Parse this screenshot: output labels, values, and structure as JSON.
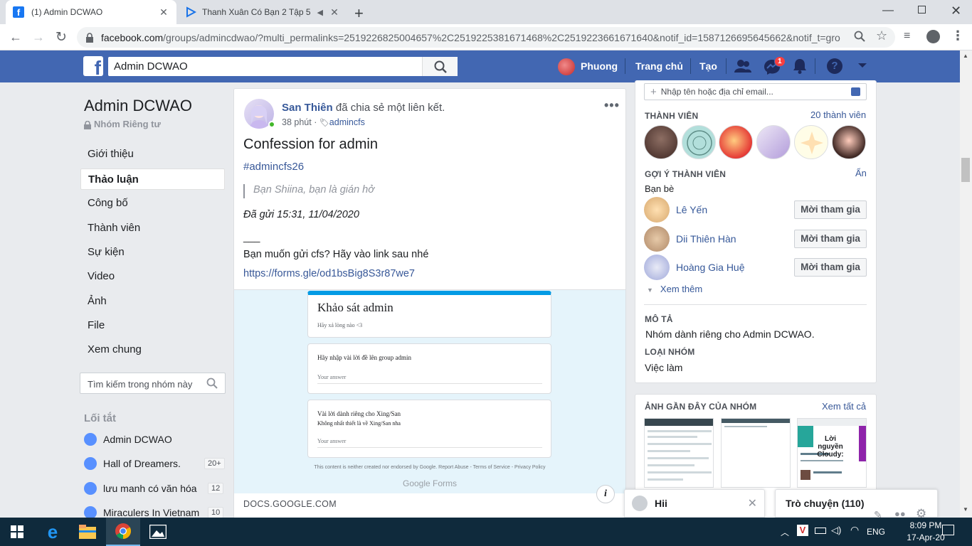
{
  "browser": {
    "tabs": [
      {
        "title": "(1) Admin DCWAO",
        "active": true
      },
      {
        "title": "Thanh Xuân Có Bạn 2 Tập 5",
        "active": false
      }
    ],
    "url_host": "facebook.com",
    "url_rest": "/groups/admincdwao/?multi_permalinks=2519226825004657%2C2519225381671468%2C2519223661671640&notif_id=1587126695645662&notif_t=gro..."
  },
  "fb_header": {
    "search_value": "Admin DCWAO",
    "user_name": "Phuong",
    "home_label": "Trang chủ",
    "create_label": "Tạo",
    "messenger_badge": "1",
    "brand_color": "#4267b2"
  },
  "group": {
    "name": "Admin DCWAO",
    "privacy": "Nhóm Riêng tư",
    "nav": [
      {
        "label": "Giới thiệu"
      },
      {
        "label": "Thảo luận",
        "selected": true
      },
      {
        "label": "Công bố"
      },
      {
        "label": "Thành viên"
      },
      {
        "label": "Sự kiện"
      },
      {
        "label": "Video"
      },
      {
        "label": "Ảnh"
      },
      {
        "label": "File"
      },
      {
        "label": "Xem chung"
      }
    ],
    "search_placeholder": "Tìm kiếm trong nhóm này",
    "shortcuts_title": "Lối tắt",
    "shortcuts": [
      {
        "label": "Admin DCWAO",
        "badge": ""
      },
      {
        "label": "Hall of Dreamers.",
        "badge": "20+"
      },
      {
        "label": "lưu manh có văn hóa",
        "badge": "12"
      },
      {
        "label": "Miraculers In Vietnam",
        "badge": "10"
      }
    ]
  },
  "post": {
    "author": "San Thiên",
    "action": "đã chia sẻ một liên kết.",
    "time": "38 phút",
    "tag": "admincfs",
    "title": "Confession for admin",
    "hashtag": "#admincfs26",
    "quote": "Bạn Shiina, bạn là gián hở",
    "sent": "Đã gửi 15:31, 11/04/2020",
    "separator": "___",
    "cta": "Bạn muốn gửi cfs? Hãy vào link sau nhé",
    "link": "https://forms.gle/od1bsBig8S3r87we7",
    "preview": {
      "form_title": "Khảo sát admin",
      "form_subtitle": "Hãy xả lòng nào <3",
      "q1": "Hãy nhập vài lời đề lên group admin",
      "q1_answer": "Your answer",
      "q2": "Vài lời dành riêng cho Xing/San",
      "q2_sub": "Không nhất thiết là về Xing/San nha",
      "q2_answer": "Your answer",
      "footer": "This content is neither created nor endorsed by Google. Report Abuse - Terms of Service - Privacy Policy",
      "brand": "Google Forms",
      "domain": "DOCS.GOOGLE.COM"
    }
  },
  "right": {
    "add_member_placeholder": "Nhập tên hoặc địa chỉ email...",
    "members_title": "THÀNH VIÊN",
    "members_count": "20 thành viên",
    "suggest_title": "GỢI Ý THÀNH VIÊN",
    "suggest_hide": "Ẩn",
    "friends_label": "Bạn bè",
    "suggestions": [
      {
        "name": "Lê Yến",
        "button": "Mời tham gia"
      },
      {
        "name": "Dii Thiên Hàn",
        "button": "Mời tham gia"
      },
      {
        "name": "Hoàng Gia Huệ",
        "button": "Mời tham gia"
      }
    ],
    "see_more": "Xem thêm",
    "desc_title": "MÔ TẢ",
    "desc": "Nhóm dành riêng cho Admin DCWAO.",
    "type_title": "LOẠI NHÓM",
    "type": "Việc làm",
    "photos_title": "ẢNH GẦN ĐÂY CỦA NHÓM",
    "photos_see_all": "Xem tất cả",
    "photo3_text": "Lời nguyền Cloudy:"
  },
  "chat": {
    "popup_name": "Hii",
    "tab_label": "Trò chuyện (110)"
  },
  "taskbar": {
    "lang": "ENG",
    "time": "8:09 PM",
    "date": "17-Apr-20"
  }
}
